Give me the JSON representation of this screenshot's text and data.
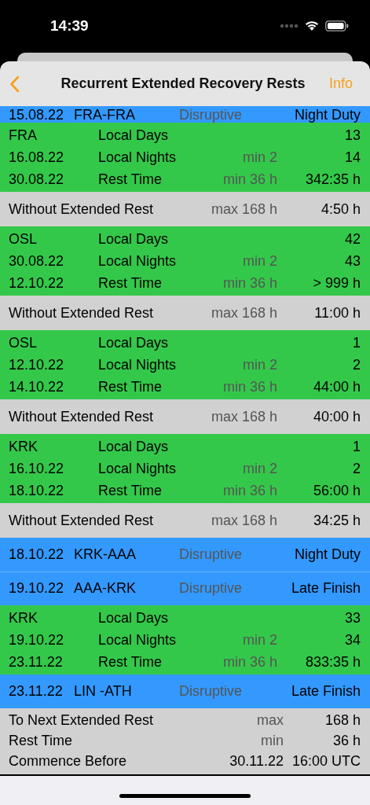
{
  "status_bar": {
    "time": "14:39"
  },
  "nav": {
    "title": "Recurrent Extended Recovery Rests",
    "action": "Info"
  },
  "rows": [
    {
      "kind": "duty",
      "date": "15.08.22",
      "route": "FRA-FRA",
      "category": "Disruptive",
      "type": "Night Duty"
    },
    {
      "kind": "rest",
      "lines": [
        {
          "label": "FRA",
          "name": "Local Days",
          "value": "13"
        },
        {
          "label": "16.08.22",
          "name": "Local Nights",
          "limit": "min 2",
          "value": "14"
        },
        {
          "label": "30.08.22",
          "name": "Rest Time",
          "limit": "min 36 h",
          "value": "342:35 h"
        }
      ]
    },
    {
      "kind": "gap",
      "label": "Without Extended Rest",
      "limit": "max 168 h",
      "value": "4:50 h"
    },
    {
      "kind": "rest",
      "lines": [
        {
          "label": "OSL",
          "name": "Local Days",
          "value": "42"
        },
        {
          "label": "30.08.22",
          "name": "Local Nights",
          "limit": "min 2",
          "value": "43"
        },
        {
          "label": "12.10.22",
          "name": "Rest Time",
          "limit": "min 36 h",
          "value": "> 999 h"
        }
      ]
    },
    {
      "kind": "gap",
      "label": "Without Extended Rest",
      "limit": "max 168 h",
      "value": "11:00 h"
    },
    {
      "kind": "rest",
      "lines": [
        {
          "label": "OSL",
          "name": "Local Days",
          "value": "1"
        },
        {
          "label": "12.10.22",
          "name": "Local Nights",
          "limit": "min 2",
          "value": "2"
        },
        {
          "label": "14.10.22",
          "name": "Rest Time",
          "limit": "min 36 h",
          "value": "44:00 h"
        }
      ]
    },
    {
      "kind": "gap",
      "label": "Without Extended Rest",
      "limit": "max 168 h",
      "value": "40:00 h"
    },
    {
      "kind": "rest",
      "lines": [
        {
          "label": "KRK",
          "name": "Local Days",
          "value": "1"
        },
        {
          "label": "16.10.22",
          "name": "Local Nights",
          "limit": "min 2",
          "value": "2"
        },
        {
          "label": "18.10.22",
          "name": "Rest Time",
          "limit": "min 36 h",
          "value": "56:00 h"
        }
      ]
    },
    {
      "kind": "gap",
      "label": "Without Extended Rest",
      "limit": "max 168 h",
      "value": "34:25 h"
    },
    {
      "kind": "duty",
      "date": "18.10.22",
      "route": "KRK-AAA",
      "category": "Disruptive",
      "type": "Night Duty"
    },
    {
      "kind": "duty",
      "date": "19.10.22",
      "route": "AAA-KRK",
      "category": "Disruptive",
      "type": "Late Finish"
    },
    {
      "kind": "rest",
      "lines": [
        {
          "label": "KRK",
          "name": "Local Days",
          "value": "33"
        },
        {
          "label": "19.10.22",
          "name": "Local Nights",
          "limit": "min 2",
          "value": "34"
        },
        {
          "label": "23.11.22",
          "name": "Rest Time",
          "limit": "min 36 h",
          "value": "833:35 h"
        }
      ]
    },
    {
      "kind": "duty",
      "date": "23.11.22",
      "route": "LIN -ATH",
      "category": "Disruptive",
      "type": "Late Finish"
    }
  ],
  "summary": [
    {
      "kind": "limit",
      "label": "To Next Extended Rest",
      "limit": "max",
      "value": "168 h"
    },
    {
      "kind": "limit",
      "label": "Rest Time",
      "limit": "min",
      "value": "36 h"
    },
    {
      "kind": "deadline",
      "label": "Commence Before",
      "limit": "30.11.22",
      "value": "16:00 UTC"
    }
  ]
}
